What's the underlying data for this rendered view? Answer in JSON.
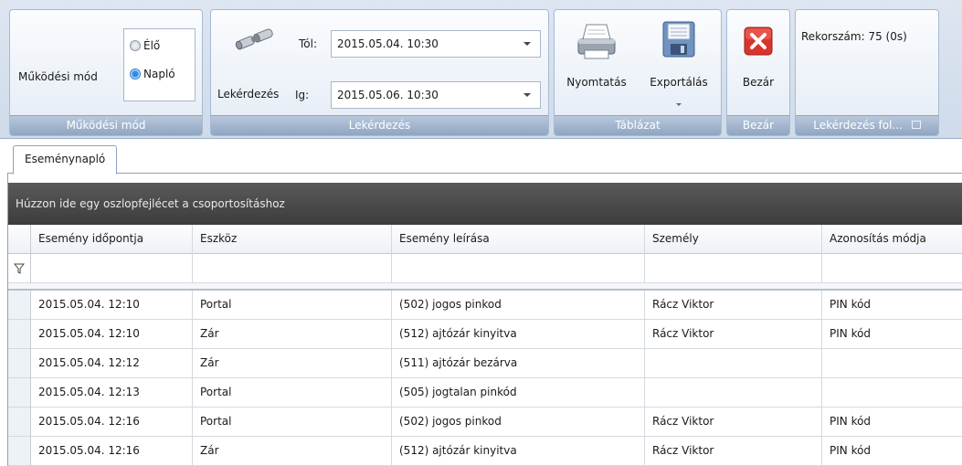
{
  "ribbon": {
    "mode_group": {
      "label": "Működési mód",
      "options": [
        "Élő",
        "Napló"
      ],
      "selected": "Napló",
      "caption": "Működési mód"
    },
    "query_group": {
      "button_label": "Lekérdezés",
      "from_label": "Tól:",
      "from_value": "2015.05.04. 10:30",
      "to_label": "Ig:",
      "to_value": "2015.05.06. 10:30",
      "caption": "Lekérdezés"
    },
    "table_group": {
      "print_label": "Nyomtatás",
      "export_label": "Exportálás",
      "caption": "Táblázat"
    },
    "close_group": {
      "close_label": "Bezár",
      "caption": "Bezár"
    },
    "info_group": {
      "records_text": "Rekorszám: 75 (0s)",
      "caption": "Lekérdezés fol..."
    }
  },
  "tabs": [
    "Eseménynapló"
  ],
  "group_panel_text": "Húzzon ide egy oszlopfejlécet a csoportosításhoz",
  "grid": {
    "columns": [
      "Esemény időpontja",
      "Eszköz",
      "Esemény leírása",
      "Személy",
      "Azonosítás módja"
    ],
    "rows": [
      [
        "2015.05.04. 12:10",
        "Portal",
        "(502) jogos pinkod",
        "Rácz Viktor",
        "PIN kód"
      ],
      [
        "2015.05.04. 12:10",
        "Zár",
        "(512) ajtózár kinyitva",
        "Rácz Viktor",
        "PIN kód"
      ],
      [
        "2015.05.04. 12:12",
        "Zár",
        "(511) ajtózár bezárva",
        "",
        ""
      ],
      [
        "2015.05.04. 12:13",
        "Portal",
        "(505) jogtalan pinkód",
        "",
        ""
      ],
      [
        "2015.05.04. 12:16",
        "Portal",
        "(502) jogos pinkod",
        "Rácz Viktor",
        "PIN kód"
      ],
      [
        "2015.05.04. 12:16",
        "Zár",
        "(512) ajtózár kinyitva",
        "Rácz Viktor",
        "PIN kód"
      ]
    ]
  },
  "icons": {
    "query": "binoculars-icon",
    "print": "printer-icon",
    "export": "floppy-disk-icon",
    "close": "red-x-icon",
    "filter": "funnel-icon"
  },
  "colors": {
    "close_red": "#d9342b",
    "group_panel": "#4a4a4a",
    "radio_selected": "#2c8de8"
  }
}
